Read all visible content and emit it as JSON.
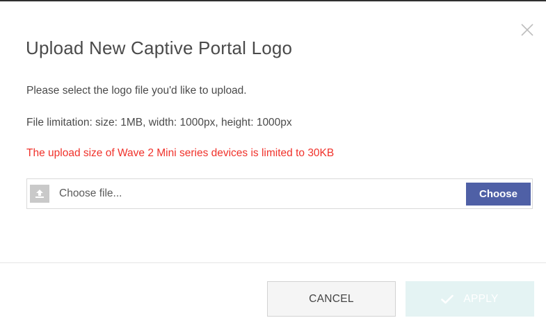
{
  "dialog": {
    "title": "Upload New Captive Portal Logo",
    "instruction": "Please select the logo file you'd like to upload.",
    "limitation": "File limitation: size: 1MB, width: 1000px, height: 1000px",
    "warning": "The upload size of Wave 2 Mini series devices is limited to 30KB",
    "close_icon": "close-icon"
  },
  "file_picker": {
    "placeholder": "Choose file...",
    "value": "",
    "choose_label": "Choose",
    "icon": "upload-icon"
  },
  "footer": {
    "cancel_label": "CANCEL",
    "apply_label": "APPLY",
    "apply_icon": "check-icon",
    "apply_enabled": false
  },
  "colors": {
    "warning": "#f0312a",
    "choose_button": "#4f60a6",
    "apply_button_disabled": "#e4f3f3",
    "title_text": "#4a4a4a"
  }
}
